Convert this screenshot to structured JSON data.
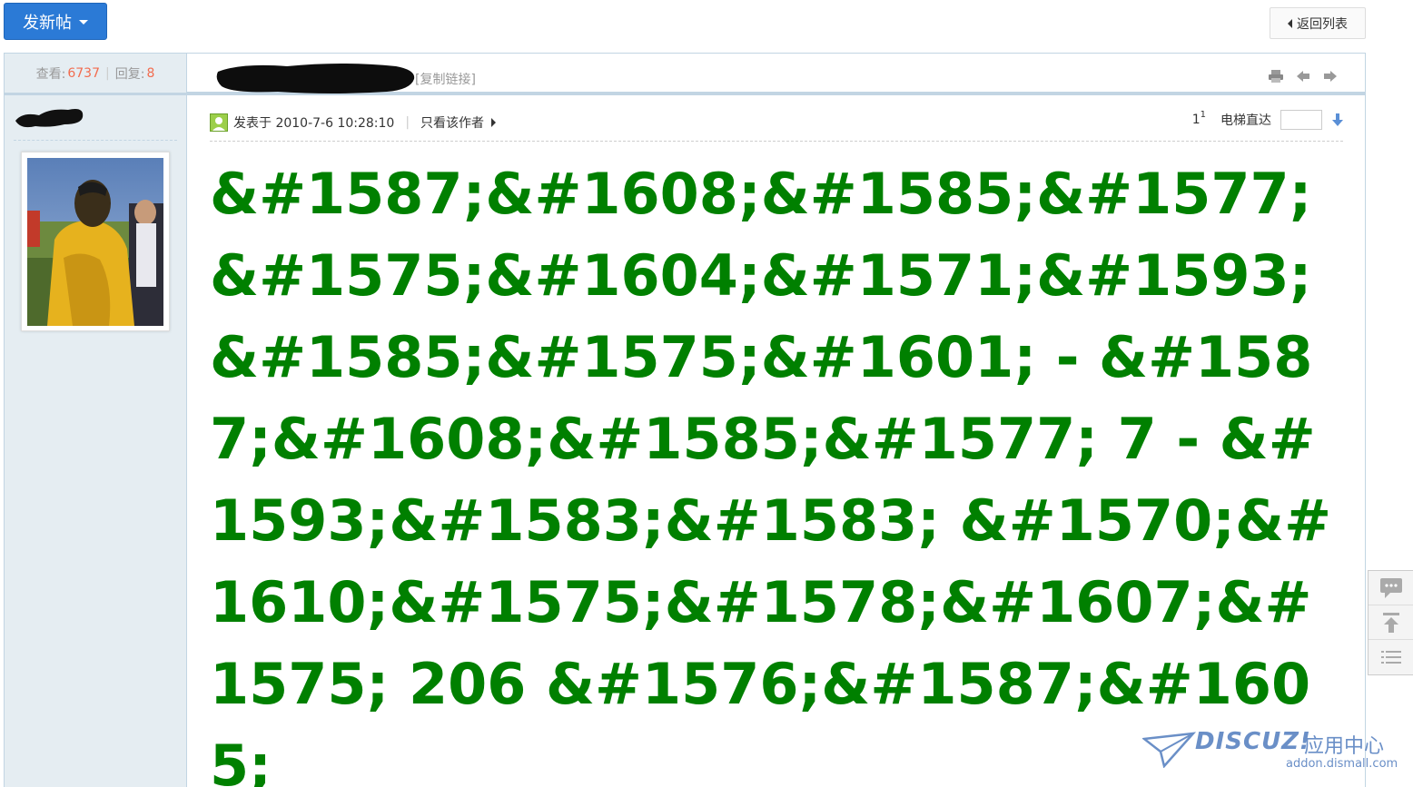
{
  "toolbar": {
    "new_post_label": "发新帖",
    "back_label": "返回列表"
  },
  "stats": {
    "views_label": "查看:",
    "views": "6737",
    "replies_label": "回复:",
    "replies": "8"
  },
  "title": {
    "copy_link_label": "[复制链接]"
  },
  "post": {
    "posted_label": "发表于 2010-7-6 10:28:10",
    "author_only_label": "只看该作者",
    "floor": "1",
    "floor_sup": "1",
    "elevator_label": "电梯直达",
    "content": "&#1587;&#1608;&#1585;&#1577; &#1575;&#1604;&#1571;&#1593;&#1585;&#1575;&#1601; - &#1587;&#1608;&#1585;&#1577; 7 - &#1593;&#1583;&#1583; &#1570;&#1610;&#1575;&#1578;&#1607;&#1575; 206 &#1576;&#1587;&#1605;"
  },
  "watermark": {
    "logo": "DISCUZ!",
    "suffix": "应用中心",
    "url": "addon.dismall.com"
  },
  "colors": {
    "primary": "#2b7ad6",
    "border": "#c2d5e3",
    "sidebar_bg": "#e5edf2",
    "content_green": "#008000",
    "accent_orange": "#f26c4f"
  },
  "icons": [
    "print-icon",
    "prev-thread-icon",
    "next-thread-icon",
    "online-user-icon",
    "down-arrow-icon",
    "reply-icon",
    "back-to-top-icon",
    "list-icon"
  ]
}
